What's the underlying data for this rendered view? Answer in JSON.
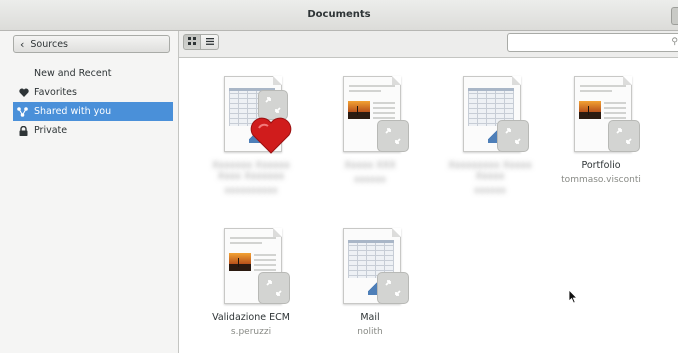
{
  "window": {
    "title": "Documents"
  },
  "sidebar": {
    "back_button_label": "Sources",
    "items": [
      {
        "label": "New and Recent",
        "icon": "none",
        "selected": false
      },
      {
        "label": "Favorites",
        "icon": "heart-icon",
        "selected": false
      },
      {
        "label": "Shared with you",
        "icon": "share-icon",
        "selected": true
      },
      {
        "label": "Private",
        "icon": "lock-icon",
        "selected": false
      }
    ]
  },
  "toolbar": {
    "grid_view_icon": "grid-view-icon",
    "list_view_icon": "list-view-icon",
    "search_placeholder": ""
  },
  "documents": [
    {
      "name": "",
      "owner": "",
      "kind": "spreadsheet",
      "favorite": true,
      "name_obscured": true
    },
    {
      "name": "",
      "owner": "",
      "kind": "document",
      "favorite": false,
      "name_obscured": true
    },
    {
      "name": "",
      "owner": "",
      "kind": "spreadsheet",
      "favorite": false,
      "name_obscured": true
    },
    {
      "name": "Portfolio",
      "owner": "tommaso.visconti",
      "kind": "document",
      "favorite": false,
      "name_obscured": false
    },
    {
      "name": "Validazione ECM",
      "owner": "s.peruzzi",
      "kind": "document",
      "favorite": false,
      "name_obscured": false
    },
    {
      "name": "Mail",
      "owner": "nolith",
      "kind": "spreadsheet",
      "favorite": false,
      "name_obscured": false
    }
  ],
  "colors": {
    "selection": "#4a90d9",
    "sidebar_bg": "#f5f5f4",
    "favorite_heart": "#d01c1c"
  }
}
